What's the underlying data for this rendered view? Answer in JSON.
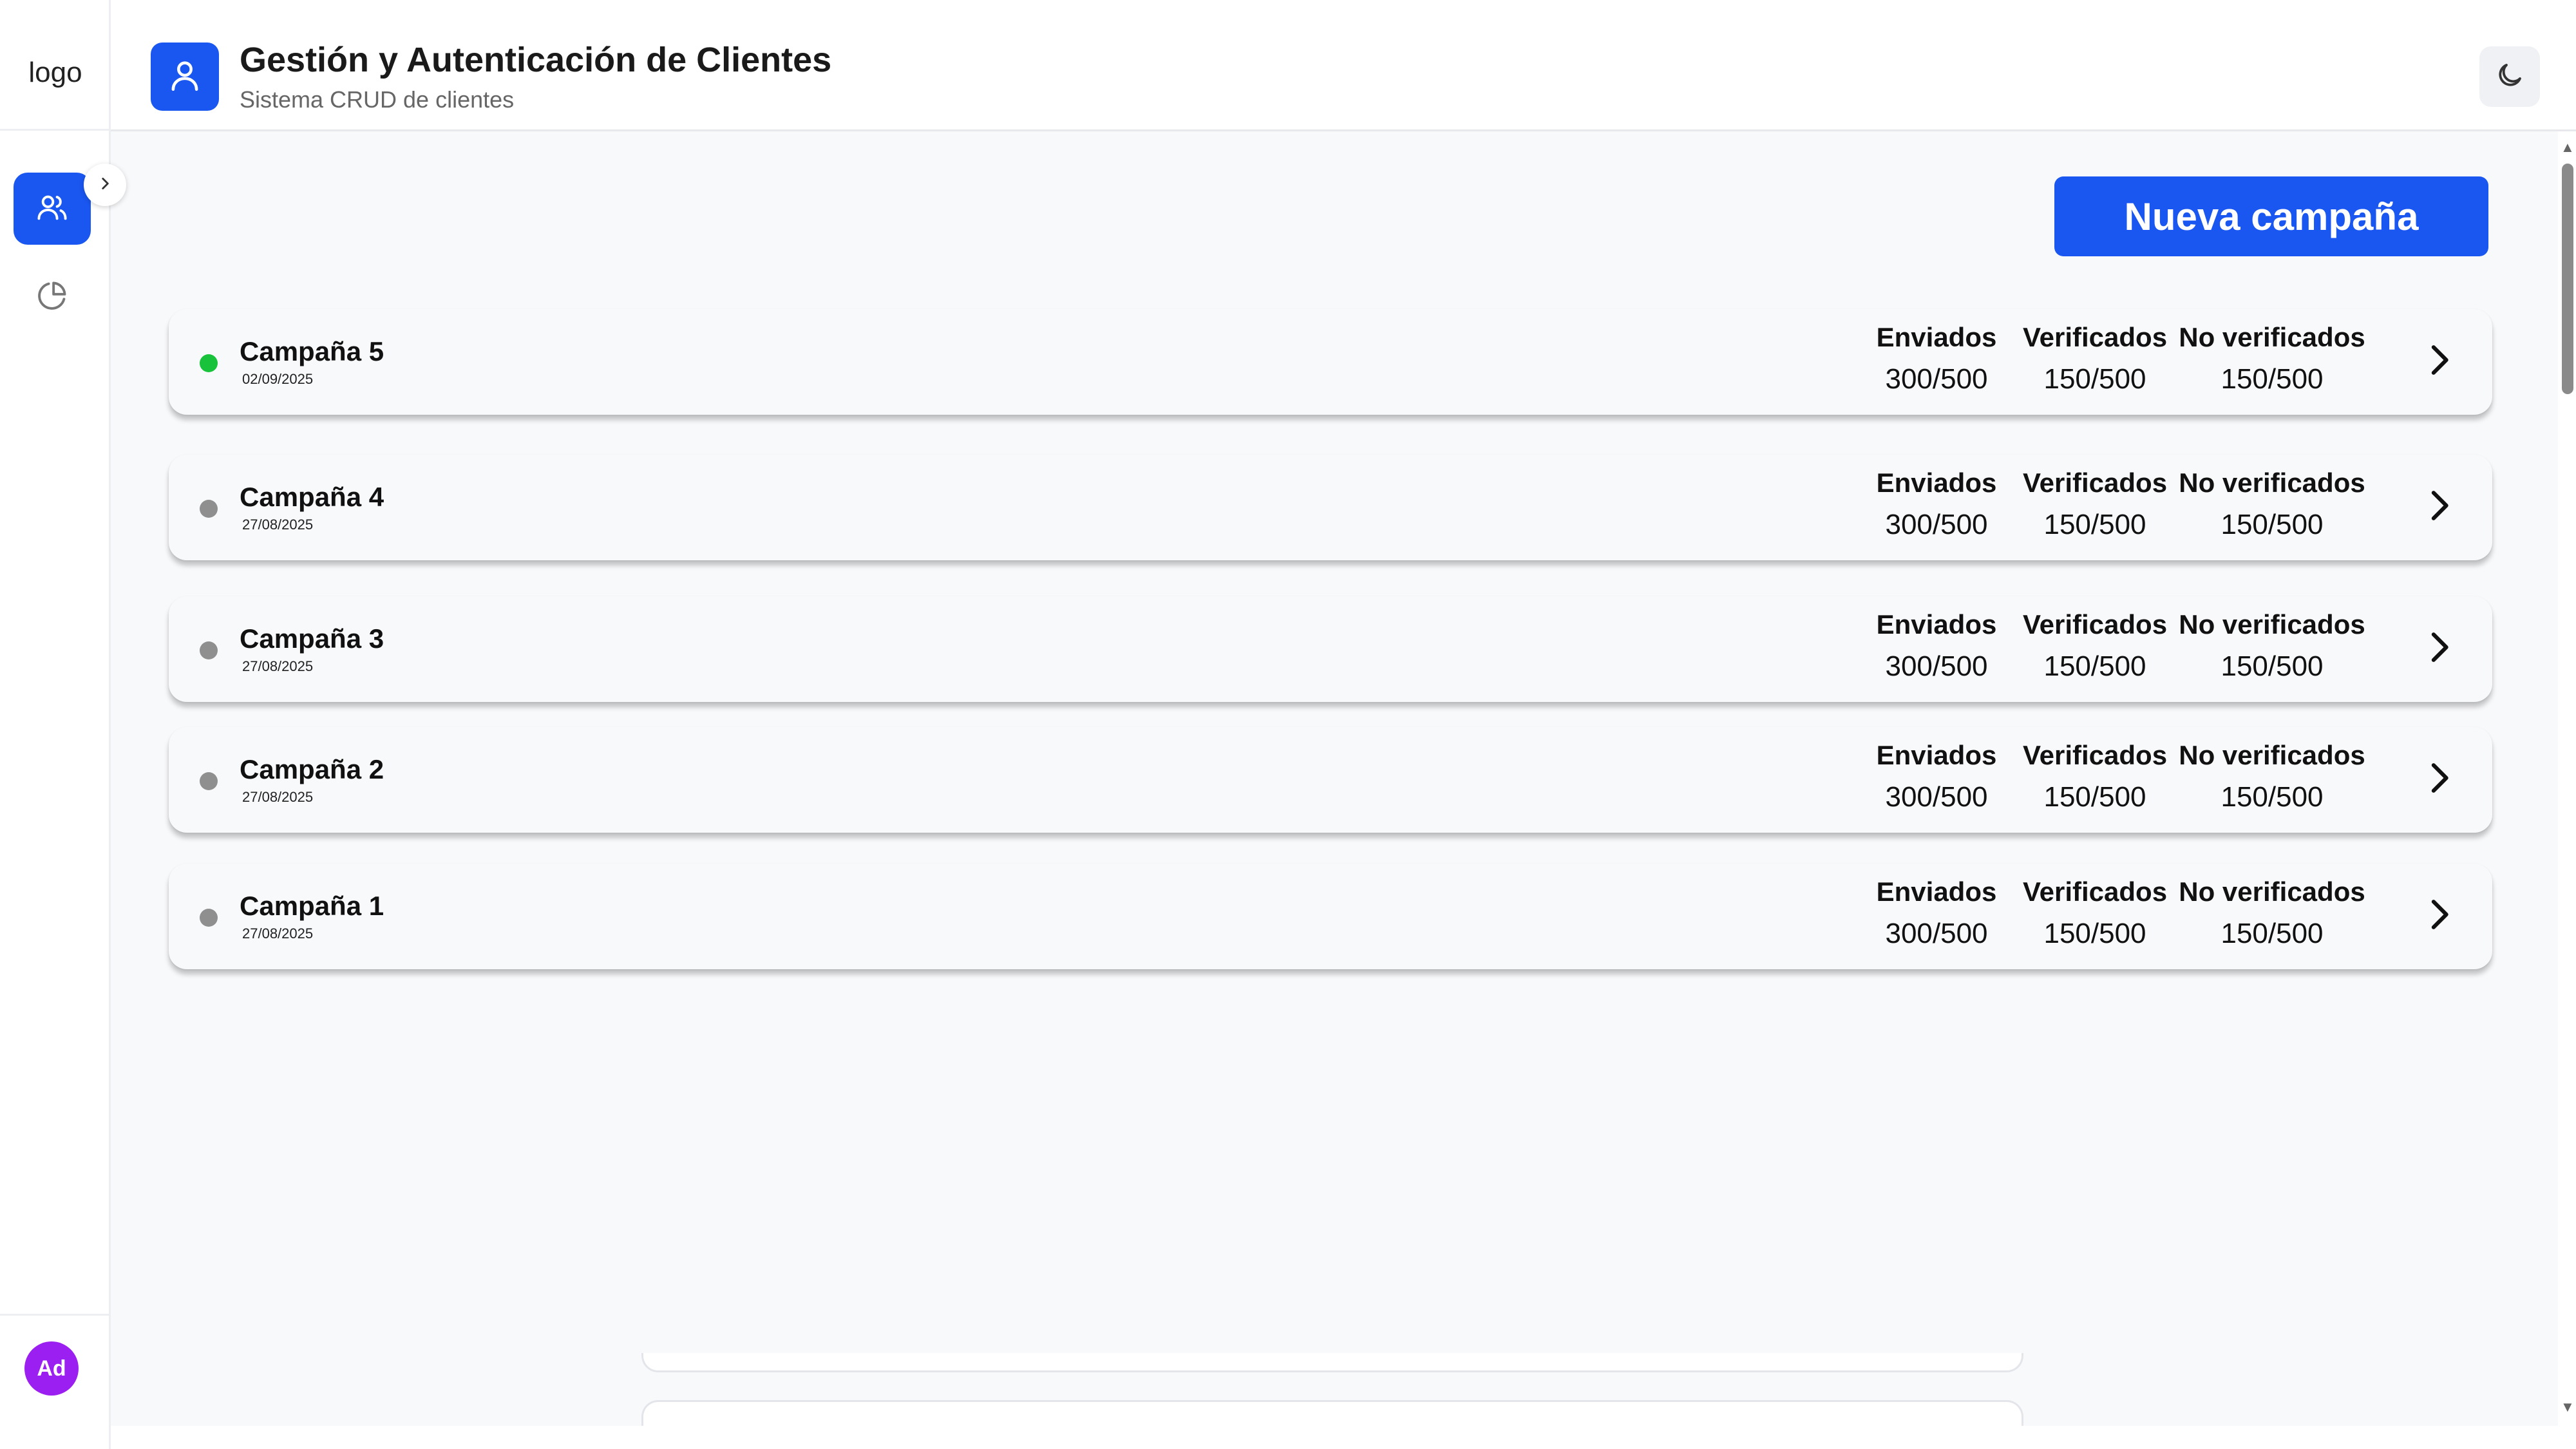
{
  "sidebar": {
    "logo": "logo",
    "nav": [
      {
        "icon": "users-icon",
        "active": true
      },
      {
        "icon": "pie-chart-icon",
        "active": false
      }
    ],
    "avatar_initials": "Ad"
  },
  "header": {
    "title": "Gestión y Autenticación de Clientes",
    "subtitle": "Sistema CRUD de clientes"
  },
  "main": {
    "new_campaign_label": "Nueva campaña",
    "stat_labels": {
      "sent": "Enviados",
      "verified": "Verificados",
      "unverified": "No verificados"
    },
    "campaigns": [
      {
        "name": "Campaña 5",
        "date": "02/09/2025",
        "status": "active",
        "sent": "300/500",
        "verified": "150/500",
        "unverified": "150/500"
      },
      {
        "name": "Campaña 4",
        "date": "27/08/2025",
        "status": "inactive",
        "sent": "300/500",
        "verified": "150/500",
        "unverified": "150/500"
      },
      {
        "name": "Campaña 3",
        "date": "27/08/2025",
        "status": "inactive",
        "sent": "300/500",
        "verified": "150/500",
        "unverified": "150/500"
      },
      {
        "name": "Campaña 2",
        "date": "27/08/2025",
        "status": "inactive",
        "sent": "300/500",
        "verified": "150/500",
        "unverified": "150/500"
      },
      {
        "name": "Campaña 1",
        "date": "27/08/2025",
        "status": "inactive",
        "sent": "300/500",
        "verified": "150/500",
        "unverified": "150/500"
      }
    ]
  },
  "colors": {
    "accent": "#1a56f0",
    "status_active": "#18c23a",
    "status_inactive": "#8f8f8f",
    "avatar": "#9b1ff0"
  }
}
